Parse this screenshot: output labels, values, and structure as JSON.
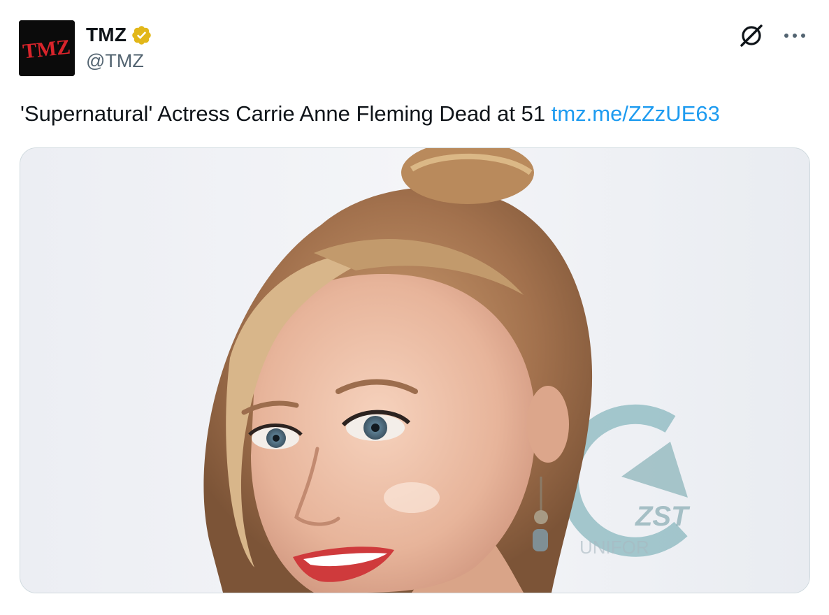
{
  "author": {
    "avatar_text": "TMZ",
    "display_name": "TMZ",
    "handle": "@TMZ",
    "verified_icon": "verified-badge-icon",
    "verified_color": "#e2b719"
  },
  "actions": {
    "grok_icon": "grok-icon",
    "more_icon": "more-horizontal-icon",
    "more_label": "···"
  },
  "tweet": {
    "text": "'Supernatural' Actress Carrie Anne Fleming Dead at 51",
    "link": "tmz.me/ZZzUE63",
    "link_color": "#1d9bf0"
  },
  "media": {
    "backdrop_text_1": "ZST",
    "backdrop_text_2": "UNIFOR"
  }
}
